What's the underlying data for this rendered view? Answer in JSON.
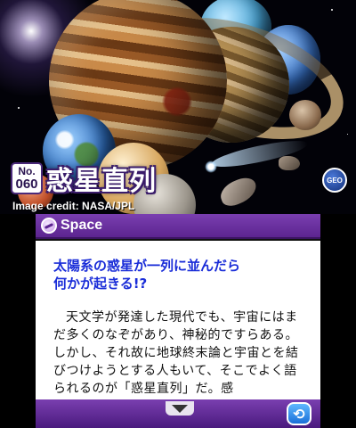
{
  "top": {
    "entry_no_label": "No.",
    "entry_no": "060",
    "title": "惑星直列",
    "credit": "Image credit: NASA/JPL",
    "badge": "GEO"
  },
  "bottom": {
    "category": "Space",
    "lead": "太陽系の惑星が一列に並んだら\n何かが起きる!?",
    "body": "天文学が発達した現代でも、宇宙にはまだ多くのなぞがあり、神秘的ですらある。しかし、それ故に地球終末論と宇宙とを結びつけようとする人もいて、そこでよく語られるのが「惑星直列」だ。感",
    "back_symbol": "⟲"
  },
  "colors": {
    "accent": "#5c2590",
    "lead_text": "#1a2dd8"
  },
  "icons": [
    "space-category-icon",
    "scroll-down-arrow-icon",
    "back-arrow-icon",
    "geo-badge-icon"
  ]
}
